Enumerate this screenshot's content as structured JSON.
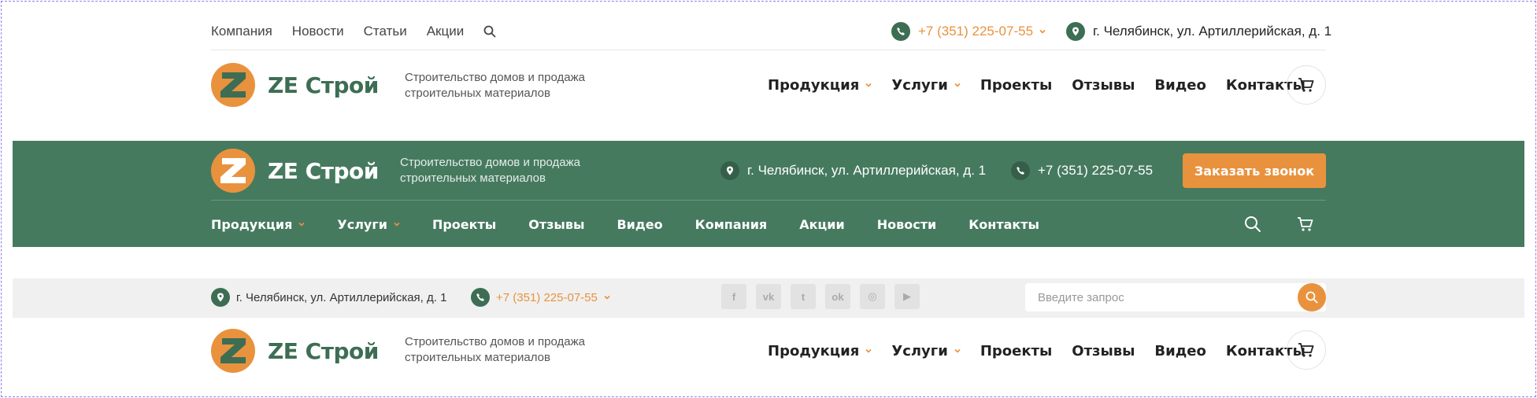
{
  "colors": {
    "brand_green": "#467a5f",
    "accent_orange": "#e9923e",
    "dark_green": "#3d6e54"
  },
  "header1": {
    "top_links": [
      {
        "label": "Компания"
      },
      {
        "label": "Новости"
      },
      {
        "label": "Статьи"
      },
      {
        "label": "Акции"
      }
    ],
    "phone": "+7 (351) 225-07-55",
    "address": "г. Челябинск, ул. Артиллерийская, д. 1",
    "logo_text": "ZE Строй",
    "tagline": "Строительство домов и продажа\nстроительных материалов",
    "nav": [
      {
        "label": "Продукция",
        "dropdown": true
      },
      {
        "label": "Услуги",
        "dropdown": true
      },
      {
        "label": "Проекты",
        "dropdown": false
      },
      {
        "label": "Отзывы",
        "dropdown": false
      },
      {
        "label": "Видео",
        "dropdown": false
      },
      {
        "label": "Контакты",
        "dropdown": false
      }
    ]
  },
  "header2": {
    "logo_text": "ZE Строй",
    "tagline": "Строительство домов и продажа\nстроительных материалов",
    "address": "г. Челябинск, ул. Артиллерийская, д. 1",
    "phone": "+7 (351) 225-07-55",
    "callback_button": "Заказать звонок",
    "nav": [
      {
        "label": "Продукция",
        "dropdown": true
      },
      {
        "label": "Услуги",
        "dropdown": true
      },
      {
        "label": "Проекты",
        "dropdown": false
      },
      {
        "label": "Отзывы",
        "dropdown": false
      },
      {
        "label": "Видео",
        "dropdown": false
      },
      {
        "label": "Компания",
        "dropdown": false
      },
      {
        "label": "Акции",
        "dropdown": false
      },
      {
        "label": "Новости",
        "dropdown": false
      },
      {
        "label": "Контакты",
        "dropdown": false
      }
    ]
  },
  "header3": {
    "address": "г. Челябинск, ул. Артиллерийская, д. 1",
    "phone": "+7 (351) 225-07-55",
    "socials": [
      {
        "icon": "facebook-icon",
        "glyph": "f"
      },
      {
        "icon": "vk-icon",
        "glyph": "vk"
      },
      {
        "icon": "twitter-icon",
        "glyph": "t"
      },
      {
        "icon": "odnoklassniki-icon",
        "glyph": "ok"
      },
      {
        "icon": "instagram-icon",
        "glyph": "◎"
      },
      {
        "icon": "youtube-icon",
        "glyph": "▶"
      }
    ],
    "search_placeholder": "Введите запрос",
    "logo_text": "ZE Строй",
    "tagline": "Строительство домов и продажа\nстроительных материалов",
    "nav": [
      {
        "label": "Продукция",
        "dropdown": true
      },
      {
        "label": "Услуги",
        "dropdown": true
      },
      {
        "label": "Проекты",
        "dropdown": false
      },
      {
        "label": "Отзывы",
        "dropdown": false
      },
      {
        "label": "Видео",
        "dropdown": false
      },
      {
        "label": "Контакты",
        "dropdown": false
      }
    ]
  }
}
